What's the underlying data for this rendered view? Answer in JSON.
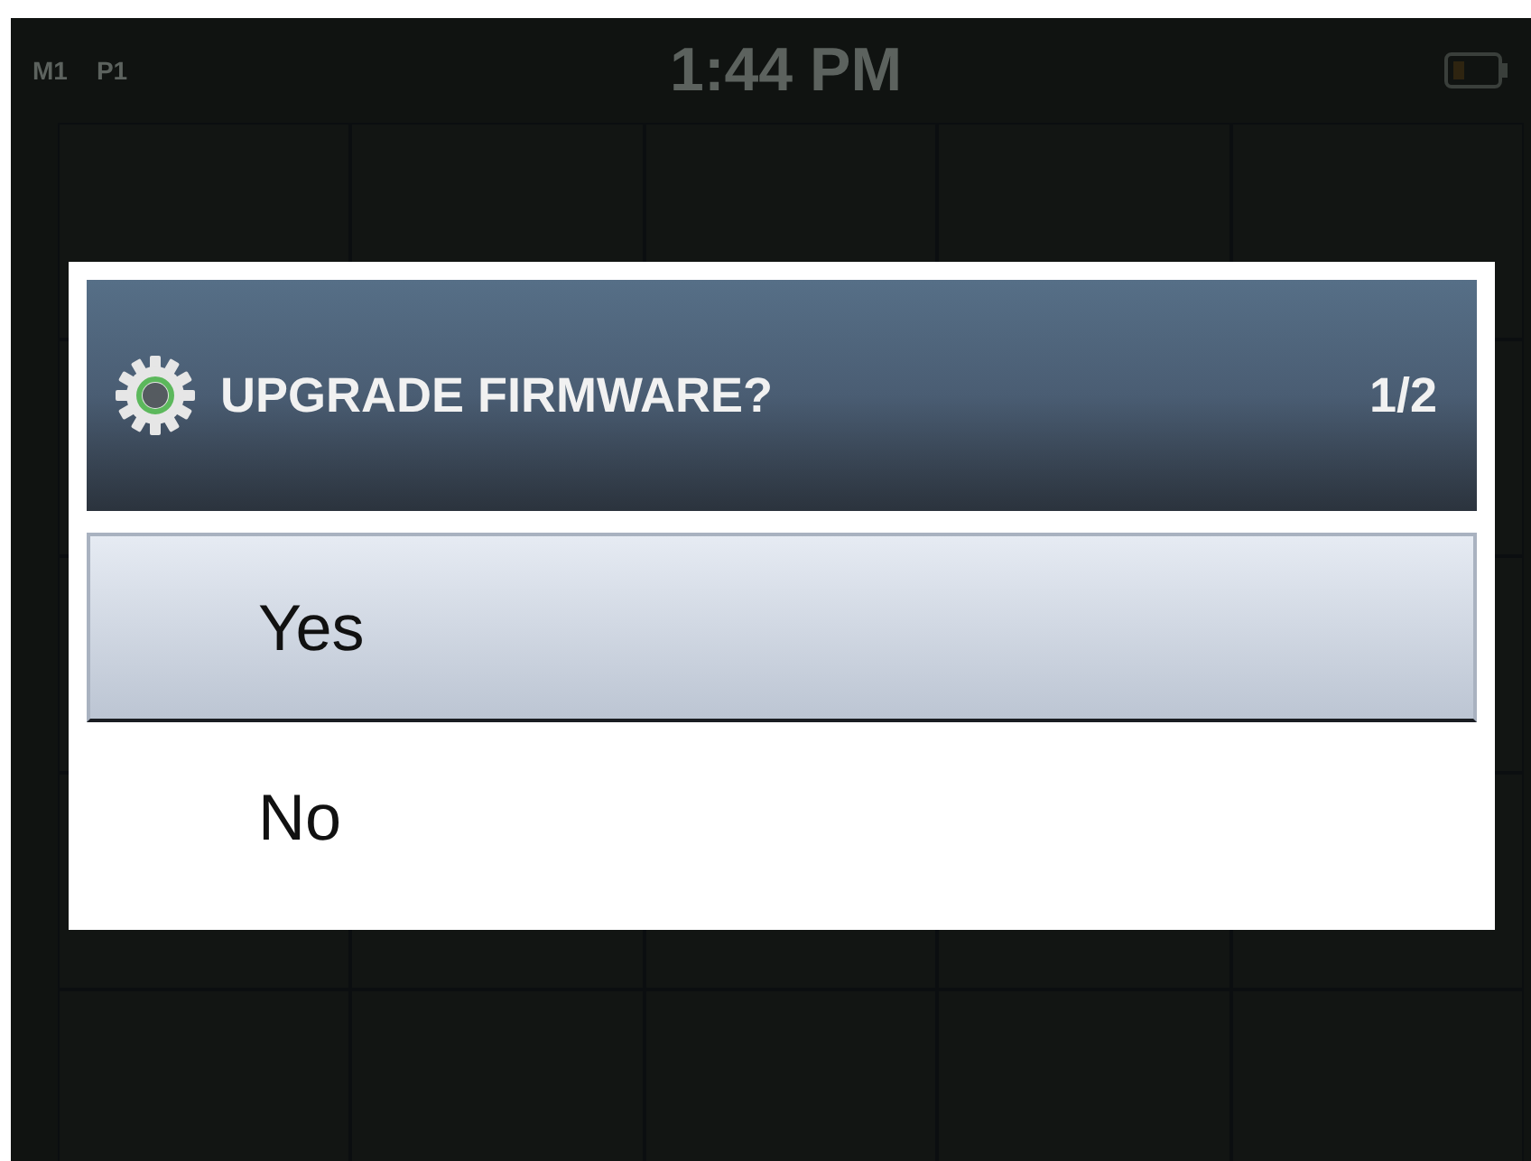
{
  "status_bar": {
    "indicators": [
      "M1",
      "P1"
    ],
    "time": "1:44 PM"
  },
  "dialog": {
    "title": "UPGRADE FIRMWARE?",
    "page": "1/2",
    "options": [
      {
        "label": "Yes",
        "selected": true
      },
      {
        "label": "No",
        "selected": false
      }
    ]
  }
}
